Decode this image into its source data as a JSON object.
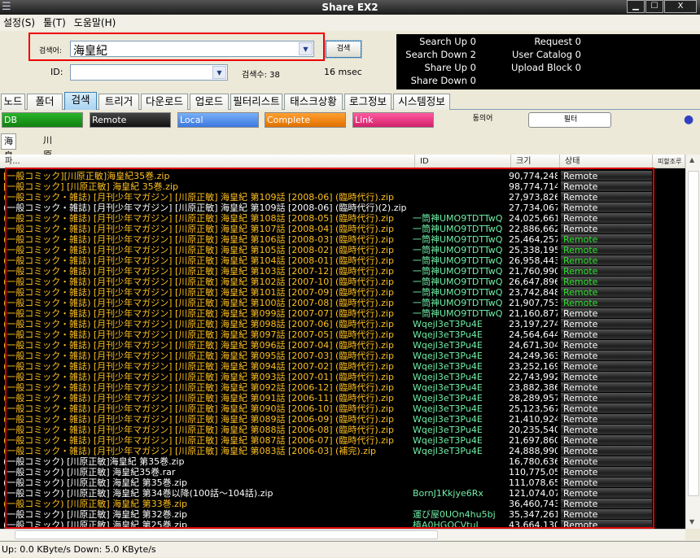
{
  "window": {
    "title": "Share EX2"
  },
  "menu": [
    "설정(S)",
    "툴(T)",
    "도움말(H)"
  ],
  "search": {
    "keyword_label": "검색어:",
    "keyword_value": "海皇紀",
    "id_label": "ID:",
    "id_value": "",
    "button": "검색",
    "result_count": "검색수: 38",
    "elapsed": "16 msec"
  },
  "stats": {
    "search_up": "Search Up  0",
    "search_down": "Search Down  2",
    "share_up": "Share Up  0",
    "share_down": "Share Down  0",
    "request": "Request  0",
    "user_catalog": "User Catalog  0",
    "upload_block": "Upload Block  0"
  },
  "tabs": [
    "노드",
    "폴더",
    "검색",
    "트리거",
    "다운로드",
    "업로드",
    "필터리스트",
    "태스크상황",
    "로그정보",
    "시스템정보"
  ],
  "active_tab": "검색",
  "filters": [
    {
      "label": "DB",
      "color": "#1a9a1a"
    },
    {
      "label": "Remote",
      "color": "#222222"
    },
    {
      "label": "Local",
      "color": "#4a8ae8"
    },
    {
      "label": "Complete",
      "color": "#f08a10"
    },
    {
      "label": "Link",
      "color": "#e83a8a"
    }
  ],
  "filter_extra": {
    "synonym": "동의어",
    "filter": "필터"
  },
  "keyword_tabs": [
    "海皇紀",
    "川原正敏"
  ],
  "columns": [
    "파...",
    "ID",
    "크기",
    "상태",
    "피할조루"
  ],
  "colors": {
    "orange_text": "#ffc020",
    "white_text": "#ffffff",
    "id_text": "#70f0a8",
    "green_state": "#30e030"
  },
  "rows": [
    {
      "name": "[一般コミック][川原正敏]海皇紀35巻.zip",
      "id": "",
      "size": "90,774,248",
      "state": "Remote",
      "tone": "o",
      "st": "w"
    },
    {
      "name": "[一般コミック] [川原正敏] 海皇紀 35巻.zip",
      "id": "",
      "size": "98,774,714",
      "state": "Remote",
      "tone": "o",
      "st": "w"
    },
    {
      "name": "(一般コミック・雑誌) [月刊少年マガジン] [川原正敏] 海皇紀 第109話 [2008-06] (臨時代行).zip",
      "id": "",
      "size": "27,973,826",
      "state": "Remote",
      "tone": "o",
      "st": "w"
    },
    {
      "name": "(一般コミック・雑誌) [月刊少年マガジン] [川原正敏] 海皇紀 第109話 [2008-06] (臨時代行)(2).zip",
      "id": "",
      "size": "27,734,067",
      "state": "Remote",
      "tone": "w",
      "st": "w"
    },
    {
      "name": "(一般コミック・雑誌) [月刊少年マガジン] [川原正敏] 海皇紀 第108話 [2008-05] (臨時代行).zip",
      "id": "一筒神UMO9TDTTwQ",
      "size": "24,025,661",
      "state": "Remote",
      "tone": "o",
      "st": "w"
    },
    {
      "name": "(一般コミック・雑誌) [月刊少年マガジン] [川原正敏] 海皇紀 第107話 [2008-04] (臨時代行).zip",
      "id": "一筒神UMO9TDTTwQ",
      "size": "22,886,662",
      "state": "Remote",
      "tone": "o",
      "st": "w"
    },
    {
      "name": "(一般コミック・雑誌) [月刊少年マガジン] [川原正敏] 海皇紀 第106話 [2008-03] (臨時代行).zip",
      "id": "一筒神UMO9TDTTwQ",
      "size": "25,464,257",
      "state": "Remote",
      "tone": "o",
      "st": "g"
    },
    {
      "name": "(一般コミック・雑誌) [月刊少年マガジン] [川原正敏] 海皇紀 第105話 [2008-02] (臨時代行).zip",
      "id": "一筒神UMO9TDTTwQ",
      "size": "25,338,195",
      "state": "Remote",
      "tone": "o",
      "st": "g"
    },
    {
      "name": "(一般コミック・雑誌) [月刊少年マガジン] [川原正敏] 海皇紀 第104話 [2008-01] (臨時代行).zip",
      "id": "一筒神UMO9TDTTwQ",
      "size": "26,958,443",
      "state": "Remote",
      "tone": "o",
      "st": "g"
    },
    {
      "name": "(一般コミック・雑誌) [月刊少年マガジン] [川原正敏] 海皇紀 第103話 [2007-12] (臨時代行).zip",
      "id": "一筒神UMO9TDTTwQ",
      "size": "21,760,990",
      "state": "Remote",
      "tone": "o",
      "st": "g"
    },
    {
      "name": "(一般コミック・雑誌) [月刊少年マガジン] [川原正敏] 海皇紀 第102話 [2007-10] (臨時代行).zip",
      "id": "一筒神UMO9TDTTwQ",
      "size": "26,647,896",
      "state": "Remote",
      "tone": "o",
      "st": "g"
    },
    {
      "name": "(一般コミック・雑誌) [月刊少年マガジン] [川原正敏] 海皇紀 第101話 [2007-09] (臨時代行).zip",
      "id": "一筒神UMO9TDTTwQ",
      "size": "23,742,848",
      "state": "Remote",
      "tone": "o",
      "st": "g"
    },
    {
      "name": "(一般コミック・雑誌) [月刊少年マガジン] [川原正敏] 海皇紀 第100話 [2007-08] (臨時代行).zip",
      "id": "一筒神UMO9TDTTwQ",
      "size": "21,907,753",
      "state": "Remote",
      "tone": "o",
      "st": "g"
    },
    {
      "name": "(一般コミック・雑誌) [月刊少年マガジン] [川原正敏] 海皇紀 第099話 [2007-07] (臨時代行).zip",
      "id": "一筒神UMO9TDTTwQ",
      "size": "21,160,877",
      "state": "Remote",
      "tone": "o",
      "st": "w"
    },
    {
      "name": "(一般コミック・雑誌) [月刊少年マガジン] [川原正敏] 海皇紀 第098話 [2007-06] (臨時代行).zip",
      "id": "WqejI3eT3Pu4E",
      "size": "23,197,274",
      "state": "Remote",
      "tone": "o",
      "st": "w"
    },
    {
      "name": "(一般コミック・雑誌) [月刊少年マガジン] [川原正敏] 海皇紀 第097話 [2007-05] (臨時代行).zip",
      "id": "WqejI3eT3Pu4E",
      "size": "24,564,644",
      "state": "Remote",
      "tone": "o",
      "st": "w"
    },
    {
      "name": "(一般コミック・雑誌) [月刊少年マガジン] [川原正敏] 海皇紀 第096話 [2007-04] (臨時代行).zip",
      "id": "WqejI3eT3Pu4E",
      "size": "24,671,304",
      "state": "Remote",
      "tone": "o",
      "st": "w"
    },
    {
      "name": "(一般コミック・雑誌) [月刊少年マガジン] [川原正敏] 海皇紀 第095話 [2007-03] (臨時代行).zip",
      "id": "WqejI3eT3Pu4E",
      "size": "24,249,363",
      "state": "Remote",
      "tone": "o",
      "st": "w"
    },
    {
      "name": "(一般コミック・雑誌) [月刊少年マガジン] [川原正敏] 海皇紀 第094話 [2007-02] (臨時代行).zip",
      "id": "WqejI3eT3Pu4E",
      "size": "23,252,169",
      "state": "Remote",
      "tone": "o",
      "st": "w"
    },
    {
      "name": "(一般コミック・雑誌) [月刊少年マガジン] [川原正敏] 海皇紀 第093話 [2007-01] (臨時代行).zip",
      "id": "WqejI3eT3Pu4E",
      "size": "22,743,992",
      "state": "Remote",
      "tone": "o",
      "st": "w"
    },
    {
      "name": "(一般コミック・雑誌) [月刊少年マガジン] [川原正敏] 海皇紀 第092話 [2006-12] (臨時代行).zip",
      "id": "WqejI3eT3Pu4E",
      "size": "23,882,386",
      "state": "Remote",
      "tone": "o",
      "st": "w"
    },
    {
      "name": "(一般コミック・雑誌) [月刊少年マガジン] [川原正敏] 海皇紀 第091話 [2006-11] (臨時代行).zip",
      "id": "WqejI3eT3Pu4E",
      "size": "28,289,957",
      "state": "Remote",
      "tone": "o",
      "st": "w"
    },
    {
      "name": "(一般コミック・雑誌) [月刊少年マガジン] [川原正敏] 海皇紀 第090話 [2006-10] (臨時代行).zip",
      "id": "WqejI3eT3Pu4E",
      "size": "25,123,567",
      "state": "Remote",
      "tone": "o",
      "st": "w"
    },
    {
      "name": "(一般コミック・雑誌) [月刊少年マガジン] [川原正敏] 海皇紀 第089話 [2006-09] (臨時代行).zip",
      "id": "WqejI3eT3Pu4E",
      "size": "21,410,924",
      "state": "Remote",
      "tone": "o",
      "st": "w"
    },
    {
      "name": "(一般コミック・雑誌) [月刊少年マガジン] [川原正敏] 海皇紀 第088話 [2006-08] (臨時代行).zip",
      "id": "WqejI3eT3Pu4E",
      "size": "20,235,540",
      "state": "Remote",
      "tone": "o",
      "st": "w"
    },
    {
      "name": "(一般コミック・雑誌) [月刊少年マガジン] [川原正敏] 海皇紀 第087話 [2006-07] (臨時代行).zip",
      "id": "WqejI3eT3Pu4E",
      "size": "21,697,860",
      "state": "Remote",
      "tone": "o",
      "st": "w"
    },
    {
      "name": "(一般コミック・雑誌) [月刊少年マガジン] [川原正敏] 海皇紀  第083話 [2006-03] (補完).zip",
      "id": "WqejI3eT3Pu4E",
      "size": "24,888,990",
      "state": "Remote",
      "tone": "o",
      "st": "w"
    },
    {
      "name": "(一般コミック) [川原正敏]海皇紀 第35巻.zip",
      "id": "",
      "size": "16,780,636",
      "state": "Remote",
      "tone": "w",
      "st": "w"
    },
    {
      "name": "(一般コミック) [川原正敏] 海皇紀35巻.rar",
      "id": "",
      "size": "110,775,058",
      "state": "Remote",
      "tone": "w",
      "st": "w"
    },
    {
      "name": "(一般コミック) [川原正敏] 海皇紀 第35巻.zip",
      "id": "",
      "size": "111,078,651",
      "state": "Remote",
      "tone": "w",
      "st": "w"
    },
    {
      "name": "(一般コミック) [川原正敏] 海皇紀 第34巻以降(100話～104話).zip",
      "id": "BornJ1Kkjye6Rx",
      "size": "121,074,076",
      "state": "Remote",
      "tone": "w",
      "st": "w"
    },
    {
      "name": "(一般コミック) [川原正敏] 海皇紀 第33巻.zip",
      "id": "",
      "size": "36,460,743",
      "state": "Remote",
      "tone": "o",
      "st": "w"
    },
    {
      "name": "(一般コミック) [川原正敏] 海皇紀 第32巻.zip",
      "id": "運び屋0UOn4hu5bj",
      "size": "35,347,261",
      "state": "Remote",
      "tone": "w",
      "st": "w"
    },
    {
      "name": "(一般コミック) [川原正敏] 海皇紀 第25巻.zip",
      "id": "植A0HGOCVtuI",
      "size": "43,664,130",
      "state": "Remote",
      "tone": "w",
      "st": "w"
    }
  ],
  "statusbar": "Up: 0.0 KByte/s Down: 5.0 KByte/s"
}
